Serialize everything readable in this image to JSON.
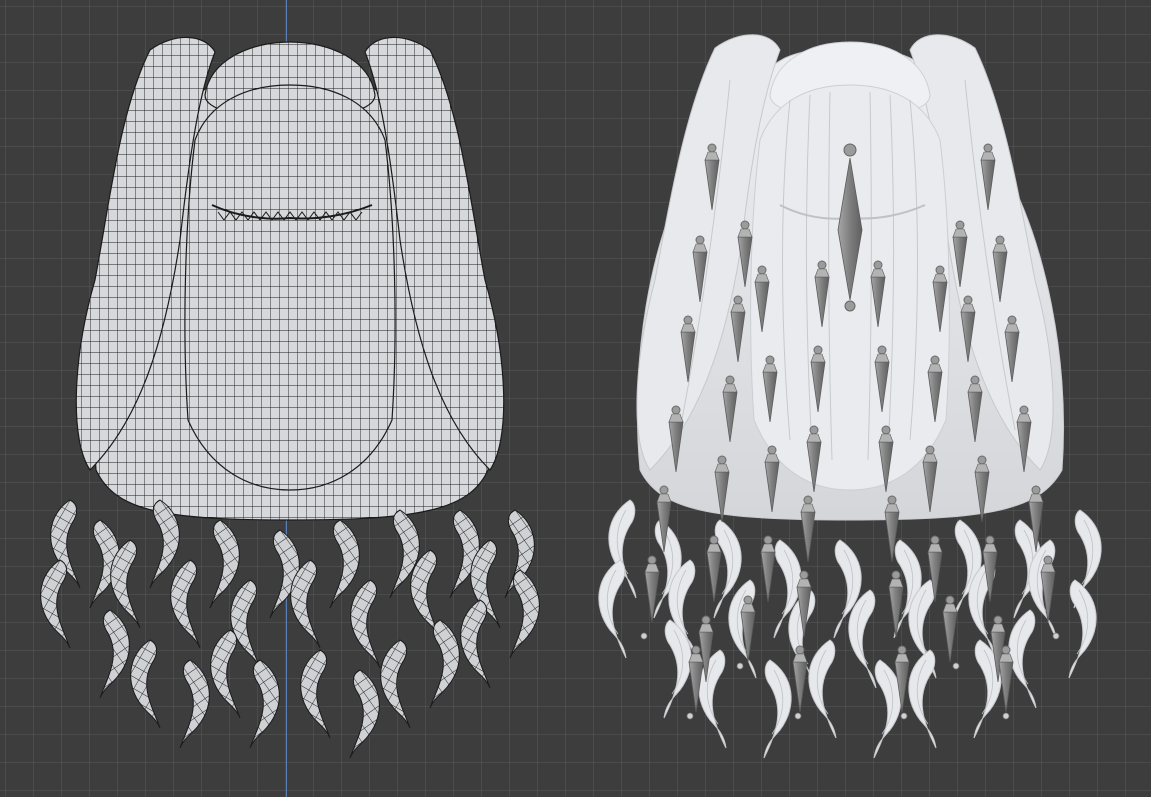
{
  "viewport": {
    "background_color": "#3d3d3d",
    "grid_color": "#4a4a4a",
    "axis_color": "#5a7fb8"
  },
  "models": [
    {
      "name": "hair-wireframe",
      "shading": "wireframe",
      "surface_color": "#d8dadd",
      "wire_color": "#1a1a1a"
    },
    {
      "name": "hair-solid-with-bones",
      "shading": "solid",
      "surface_color": "#e2e4e7",
      "bone_color": "#8a8a8a"
    }
  ]
}
